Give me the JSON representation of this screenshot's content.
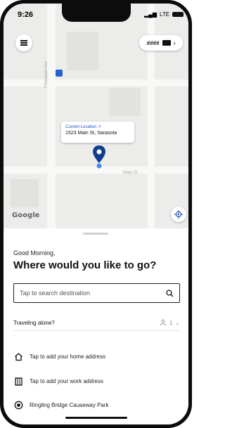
{
  "status_bar": {
    "time": "9:26",
    "network": "LTE"
  },
  "map": {
    "labels": {
      "street_left": "Pineapple Ave",
      "street_right": "Main St"
    },
    "current_location": {
      "title": "Current Location ↗",
      "address": "1523 Main St, Sarasota"
    },
    "attribution": "Google",
    "account_mask": "####"
  },
  "sheet": {
    "greeting": "Good Morning,",
    "headline": "Where would you like to go?",
    "search_placeholder": "Tap to search destination",
    "traveling_label": "Traveling alone?",
    "passenger_count": "1",
    "items": [
      {
        "label": "Tap to add your home address",
        "icon": "home-icon"
      },
      {
        "label": "Tap to add your work address",
        "icon": "building-icon"
      },
      {
        "label": "Ringling Bridge Causeway Park",
        "icon": "place-radio-icon"
      }
    ]
  },
  "colors": {
    "accent": "#1f4fb8",
    "pin": "#0f3f8c"
  }
}
